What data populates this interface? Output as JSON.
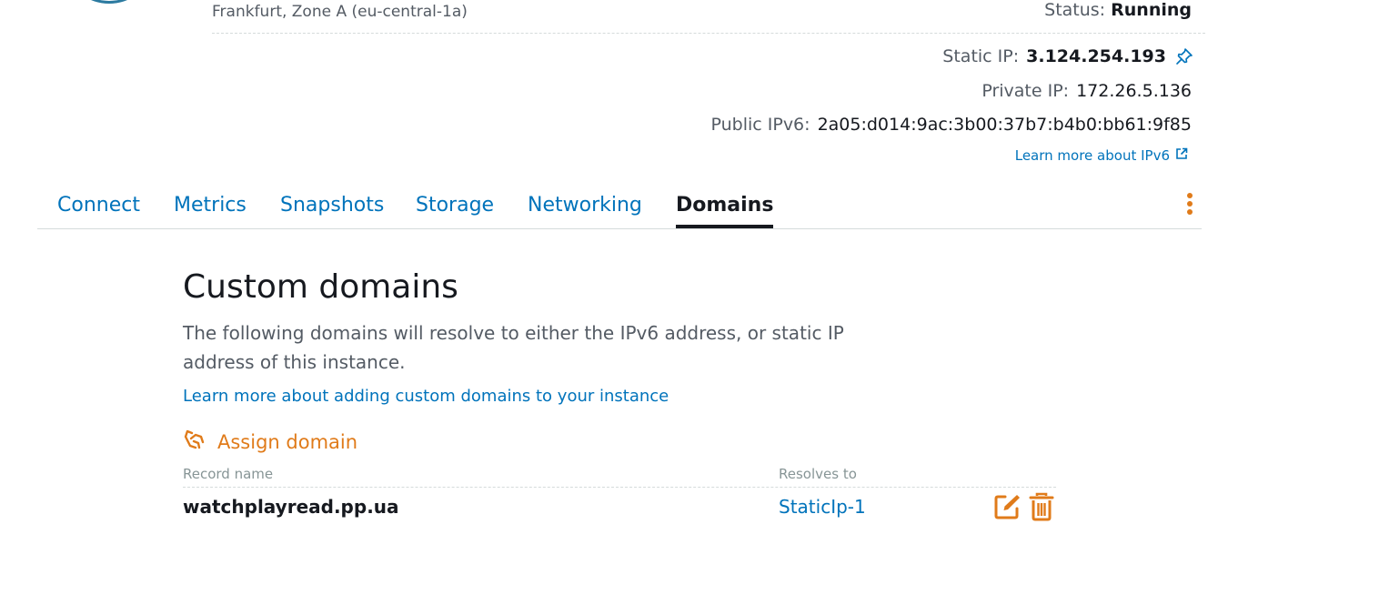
{
  "instance": {
    "location": "Frankfurt, Zone A (eu-central-1a)",
    "status_label": "Status:",
    "status_value": "Running"
  },
  "ips": {
    "static_label": "Static IP:",
    "static_value": "3.124.254.193",
    "private_label": "Private IP:",
    "private_value": "172.26.5.136",
    "ipv6_label": "Public IPv6:",
    "ipv6_value": "2a05:d014:9ac:3b00:37b7:b4b0:bb61:9f85",
    "learn_ipv6": "Learn more about IPv6"
  },
  "tabs": [
    {
      "label": "Connect"
    },
    {
      "label": "Metrics"
    },
    {
      "label": "Snapshots"
    },
    {
      "label": "Storage"
    },
    {
      "label": "Networking"
    },
    {
      "label": "Domains",
      "active": true
    }
  ],
  "domains": {
    "title": "Custom domains",
    "description": "The following domains will resolve to either the IPv6 address, or static IP address of this instance.",
    "learn_link": "Learn more about adding custom domains to your instance",
    "assign_label": "Assign domain",
    "columns": {
      "record": "Record name",
      "resolves": "Resolves to"
    },
    "rows": [
      {
        "record": "watchplayread.pp.ua",
        "resolves": "StaticIp-1"
      }
    ]
  },
  "colors": {
    "link": "#0073bb",
    "accent": "#e07b1a",
    "text": "#16191f",
    "muted": "#545b64"
  },
  "icons": [
    "pin-icon",
    "external-link-icon",
    "more-actions-icon",
    "assign-domain-icon",
    "edit-icon",
    "delete-icon"
  ]
}
